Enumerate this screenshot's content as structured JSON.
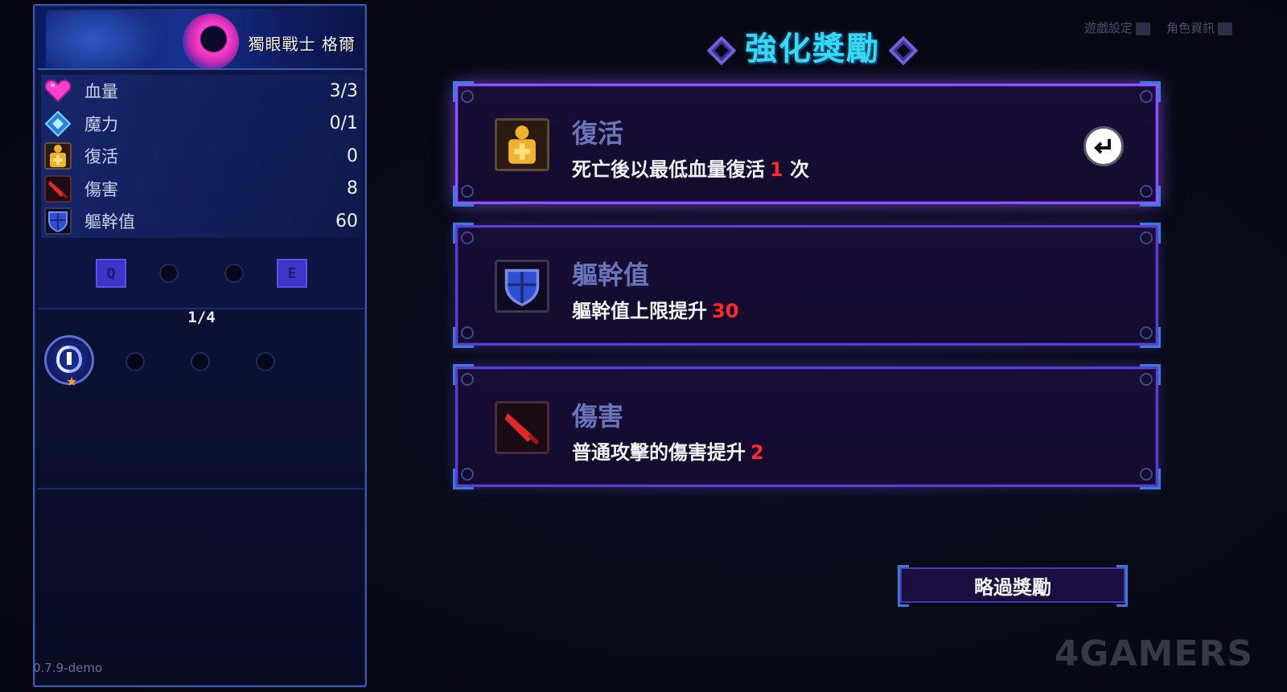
{
  "character": {
    "name": "獨眼戰士 格爾"
  },
  "stats": [
    {
      "label": "血量",
      "value": "3/3",
      "icon": "heart-icon",
      "color": "#ff3fd0"
    },
    {
      "label": "魔力",
      "value": "0/1",
      "icon": "mana-crystal-icon",
      "color": "#3fa8ff"
    },
    {
      "label": "復活",
      "value": "0",
      "icon": "revive-idol-icon",
      "color": "#f0b030"
    },
    {
      "label": "傷害",
      "value": "8",
      "icon": "sword-icon",
      "color": "#e02a2a"
    },
    {
      "label": "軀幹值",
      "value": "60",
      "icon": "shield-icon",
      "color": "#2f4fd0"
    }
  ],
  "skills": {
    "left_key": "Q",
    "right_key": "E"
  },
  "relics": {
    "count": "1/4"
  },
  "version": "0.7.9-demo",
  "header": {
    "title": "強化獎勵",
    "settings_label": "遊戲設定",
    "character_info_label": "角色資訊"
  },
  "rewards": [
    {
      "title": "復活",
      "desc": "死亡後以最低血量復活",
      "num": "1",
      "suffix": "次",
      "icon": "revive-idol-icon",
      "selected": true
    },
    {
      "title": "軀幹值",
      "desc": "軀幹值上限提升",
      "num": "30",
      "suffix": "",
      "icon": "shield-icon",
      "selected": false
    },
    {
      "title": "傷害",
      "desc": "普通攻擊的傷害提升",
      "num": "2",
      "suffix": "",
      "icon": "sword-icon",
      "selected": false
    }
  ],
  "skip_label": "略過獎勵",
  "watermark": "4GAMERS",
  "colors": {
    "title": "#38d8f0",
    "card_border": "#5a3ed0",
    "highlight_number": "#ff2a2a",
    "corner_accent": "#3a7ad8"
  }
}
